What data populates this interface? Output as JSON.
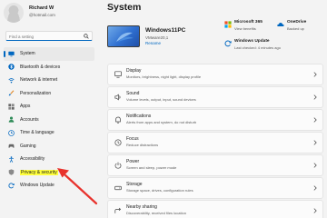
{
  "profile": {
    "name": "Richard W",
    "email": "@hotmail.com"
  },
  "search": {
    "placeholder": "Find a setting"
  },
  "sidebar": {
    "items": [
      {
        "label": "System",
        "icon": "monitor-icon",
        "color": "#0067c0"
      },
      {
        "label": "Bluetooth & devices",
        "icon": "bluetooth-icon",
        "color": "#0067c0"
      },
      {
        "label": "Network & internet",
        "icon": "wifi-icon",
        "color": "#0067c0"
      },
      {
        "label": "Personalization",
        "icon": "brush-icon",
        "color": "#e08a2c"
      },
      {
        "label": "Apps",
        "icon": "apps-icon",
        "color": "#555555"
      },
      {
        "label": "Accounts",
        "icon": "person-icon",
        "color": "#2e8b57"
      },
      {
        "label": "Time & language",
        "icon": "globe-clock-icon",
        "color": "#0067c0"
      },
      {
        "label": "Gaming",
        "icon": "controller-icon",
        "color": "#555555"
      },
      {
        "label": "Accessibility",
        "icon": "accessibility-icon",
        "color": "#0067c0"
      },
      {
        "label": "Privacy & security",
        "icon": "shield-icon",
        "color": "#7a7a7a"
      },
      {
        "label": "Windows Update",
        "icon": "update-icon",
        "color": "#0067c0"
      }
    ]
  },
  "main": {
    "title": "System",
    "device": {
      "name": "Windows11PC",
      "model": "VMware20,1",
      "rename": "Rename"
    },
    "quick": [
      {
        "title": "Microsoft 365",
        "subtitle": "View benefits",
        "icon": "microsoft-365-icon"
      },
      {
        "title": "OneDrive",
        "subtitle": "Backed up",
        "icon": "onedrive-icon"
      },
      {
        "title": "Windows Update",
        "subtitle": "Last checked: 4 minutes ago",
        "icon": "update-icon"
      }
    ],
    "cards": [
      {
        "title": "Display",
        "subtitle": "Monitors, brightness, night light, display profile",
        "icon": "display-icon"
      },
      {
        "title": "Sound",
        "subtitle": "Volume levels, output, input, sound devices",
        "icon": "speaker-icon"
      },
      {
        "title": "Notifications",
        "subtitle": "Alerts from apps and system, do not disturb",
        "icon": "bell-icon"
      },
      {
        "title": "Focus",
        "subtitle": "Reduce distractions",
        "icon": "focus-icon"
      },
      {
        "title": "Power",
        "subtitle": "Screen and sleep, power mode",
        "icon": "power-icon"
      },
      {
        "title": "Storage",
        "subtitle": "Storage space, drives, configuration rules",
        "icon": "storage-icon"
      },
      {
        "title": "Nearby sharing",
        "subtitle": "Discoverability, received files location",
        "icon": "share-icon"
      }
    ]
  },
  "colors": {
    "accent": "#0067c0",
    "highlight": "#ffff3c",
    "arrow": "#e8322c"
  }
}
